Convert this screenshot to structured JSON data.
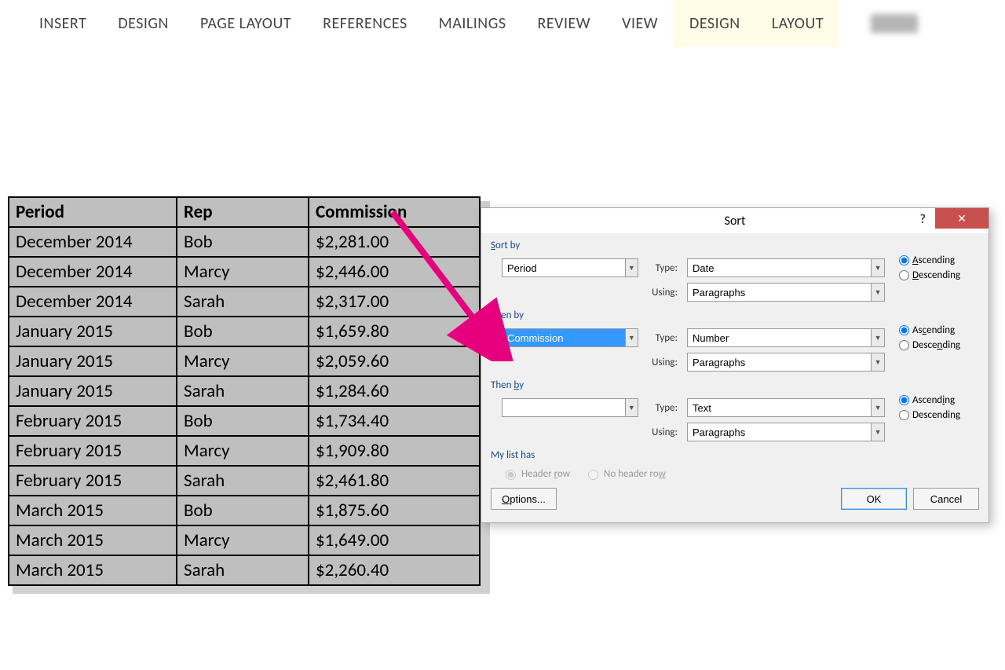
{
  "ribbon": {
    "tabs": [
      "INSERT",
      "DESIGN",
      "PAGE LAYOUT",
      "REFERENCES",
      "MAILINGS",
      "REVIEW",
      "VIEW",
      "DESIGN",
      "LAYOUT"
    ]
  },
  "table": {
    "headers": [
      "Period",
      "Rep",
      "Commission"
    ],
    "rows": [
      [
        "December 2014",
        "Bob",
        "$2,281.00"
      ],
      [
        "December 2014",
        "Marcy",
        "$2,446.00"
      ],
      [
        "December 2014",
        "Sarah",
        "$2,317.00"
      ],
      [
        "January 2015",
        "Bob",
        "$1,659.80"
      ],
      [
        "January 2015",
        "Marcy",
        "$2,059.60"
      ],
      [
        "January 2015",
        "Sarah",
        "$1,284.60"
      ],
      [
        "February 2015",
        "Bob",
        "$1,734.40"
      ],
      [
        "February 2015",
        "Marcy",
        "$1,909.80"
      ],
      [
        "February 2015",
        "Sarah",
        "$2,461.80"
      ],
      [
        "March 2015",
        "Bob",
        "$1,875.60"
      ],
      [
        "March 2015",
        "Marcy",
        "$1,649.00"
      ],
      [
        "March 2015",
        "Sarah",
        "$2,260.40"
      ]
    ]
  },
  "dialog": {
    "title": "Sort",
    "labels": {
      "sort_by": "Sort by",
      "then_by": "Then by",
      "then_by2": "Then by",
      "type": "Type:",
      "using": "Using:",
      "ascending": "Ascending",
      "descending": "Descending",
      "my_list_has": "My list has",
      "header_row": "Header row",
      "no_header_row": "No header row",
      "options": "Options...",
      "ok": "OK",
      "cancel": "Cancel"
    },
    "level1": {
      "field": "Period",
      "type": "Date",
      "using": "Paragraphs",
      "dir": "asc"
    },
    "level2": {
      "field": "Commission",
      "type": "Number",
      "using": "Paragraphs",
      "dir": "asc"
    },
    "level3": {
      "field": "",
      "type": "Text",
      "using": "Paragraphs",
      "dir": "asc"
    },
    "header_row": true
  }
}
